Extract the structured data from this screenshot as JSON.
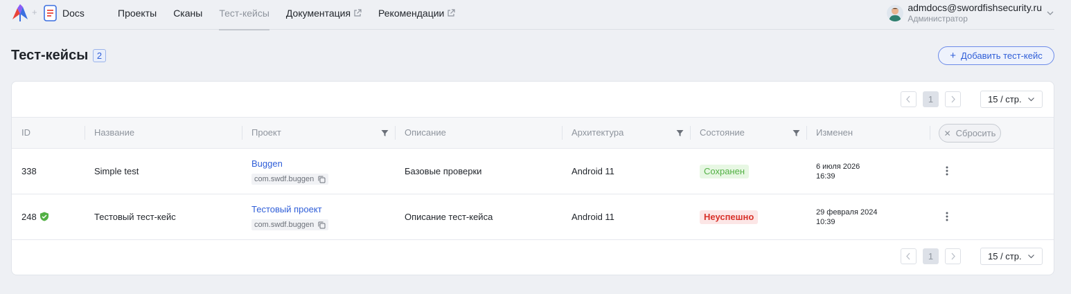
{
  "header": {
    "app_name": "Docs",
    "nav": [
      {
        "label": "Проекты",
        "external": false,
        "active": false
      },
      {
        "label": "Сканы",
        "external": false,
        "active": false
      },
      {
        "label": "Тест-кейсы",
        "external": false,
        "active": true
      },
      {
        "label": "Документация",
        "external": true,
        "active": false
      },
      {
        "label": "Рекомендации",
        "external": true,
        "active": false
      }
    ],
    "user": {
      "email": "admdocs@swordfishsecurity.ru",
      "role": "Администратор"
    }
  },
  "page": {
    "title": "Тест-кейсы",
    "count": "2",
    "add_button": "Добавить тест-кейс"
  },
  "pagination": {
    "prev": "<",
    "page": "1",
    "next": ">",
    "page_size": "15 / стр."
  },
  "table": {
    "columns": {
      "id": "ID",
      "name": "Название",
      "project": "Проект",
      "description": "Описание",
      "architecture": "Архитектура",
      "state": "Состояние",
      "changed": "Изменен",
      "reset": "Сбросить"
    },
    "rows": [
      {
        "id": "338",
        "name": "Simple test",
        "project": "Buggen",
        "package": "com.swdf.buggen",
        "description": "Базовые проверки",
        "architecture": "Android 11",
        "state": "Сохранен",
        "date": "6 июля 2026",
        "time": "16:39"
      },
      {
        "id": "248",
        "name": "Тестовый тест-кейс",
        "project": "Тестовый проект",
        "package": "com.swdf.buggen",
        "description": "Описание тест-кейса",
        "architecture": "Android 11",
        "state": "Неуспешно",
        "date": "29 февраля 2024",
        "time": "10:39"
      }
    ]
  },
  "colors": {
    "accent": "#2f5ed8",
    "success": "#52b044",
    "danger": "#d8322a"
  }
}
